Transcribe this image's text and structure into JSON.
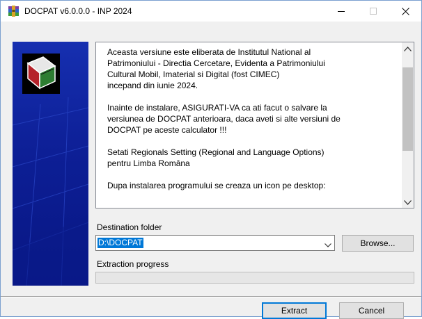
{
  "window": {
    "title": "DOCPAT v6.0.0.0 - INP 2024",
    "app_icon": "winrar-archive-icon",
    "controls": {
      "minimize_icon": "minimize-icon",
      "maximize_icon": "maximize-icon",
      "close_icon": "close-icon"
    }
  },
  "side_panel": {
    "logo_icon": "docpat-book-logo-icon"
  },
  "info": {
    "paragraphs": [
      "Aceasta versiune este eliberata de Institutul National al\nPatrimoniului - Directia Cercetare, Evidenta a Patrimoniului\nCultural Mobil, Imaterial si Digital (fost CIMEC)\nincepand din iunie 2024.",
      "Inainte de instalare, ASIGURATI-VA ca ati facut o salvare la\nversiunea de DOCPAT anterioara, daca aveti si alte versiuni de\nDOCPAT pe aceste calculator !!!",
      "Setati Regionals Setting (Regional and Language Options)\npentru Limba Româna",
      "Dupa instalarea programului se creaza un icon pe desktop:"
    ]
  },
  "destination": {
    "label": "Destination folder",
    "value": "D:\\DOCPAT",
    "browse_label": "Browse..."
  },
  "progress": {
    "label": "Extraction progress",
    "fraction": 0
  },
  "buttons": {
    "extract_label": "Extract",
    "cancel_label": "Cancel"
  },
  "colors": {
    "accent": "#0078d7",
    "side_panel": "#0d1f96",
    "progress_fill": "#06b025"
  }
}
